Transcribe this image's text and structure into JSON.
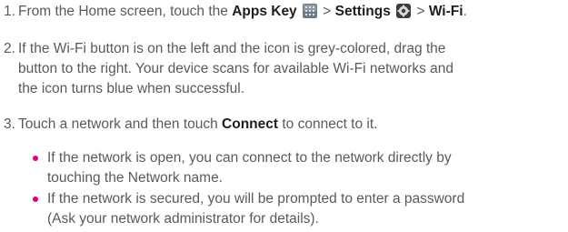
{
  "steps": [
    {
      "number": "1.",
      "text_before": "From the Home screen, touch the ",
      "apps_key": "Apps Key",
      "sep1": " > ",
      "settings": "Settings",
      "sep2": " > ",
      "wifi": "Wi-Fi",
      "end": "."
    },
    {
      "number": "2.",
      "line1": "If the Wi-Fi button is on the left and the icon is grey-colored, drag the",
      "line2": "button to the right. Your device scans for available Wi-Fi networks and",
      "line3": "the icon turns blue when successful."
    },
    {
      "number": "3.",
      "text_before": "Touch a network and then touch ",
      "connect": "Connect",
      "text_after": " to connect to it."
    }
  ],
  "bullets": [
    {
      "line1": "If the network is open, you can connect to the network directly by",
      "line2": "touching the Network name."
    },
    {
      "line1": "If the network is secured, you will be prompted to enter a password",
      "line2": "(Ask your network administrator for details)."
    }
  ],
  "icons": {
    "apps_key": "apps-grid-icon",
    "settings": "settings-gear-icon"
  },
  "colors": {
    "text": "#5a5a5a",
    "bold_text": "#1e1e1e",
    "bullet": "#e0007a"
  }
}
